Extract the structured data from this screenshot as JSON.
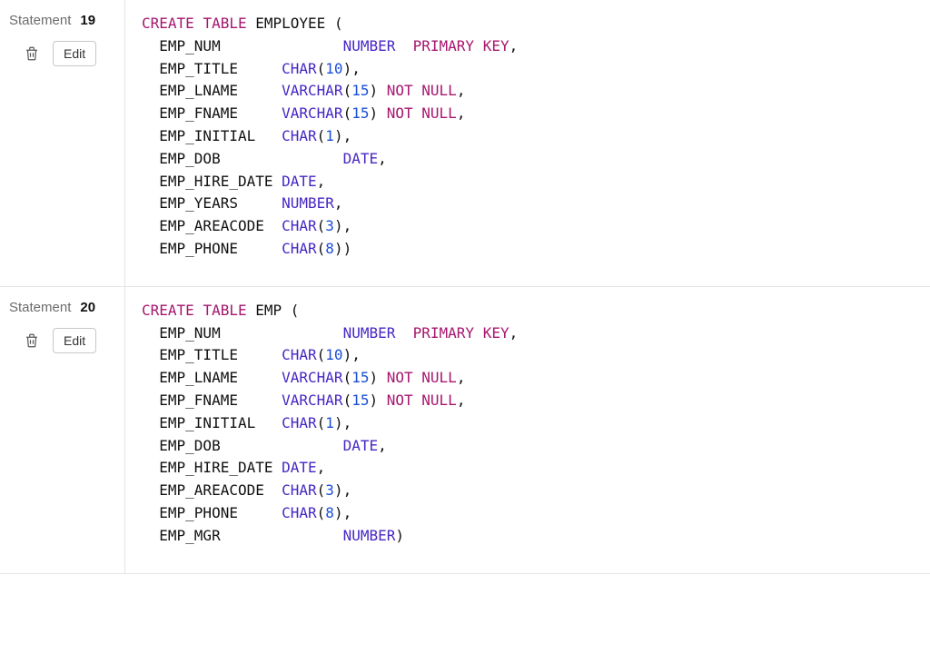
{
  "statement_label": "Statement",
  "edit_label": "Edit",
  "statements": [
    {
      "number": "19",
      "sql": [
        {
          "t": "kw",
          "v": "CREATE"
        },
        {
          "t": "id",
          "v": " "
        },
        {
          "t": "kw",
          "v": "TABLE"
        },
        {
          "t": "id",
          "v": " EMPLOYEE ("
        },
        {
          "t": "nl"
        },
        {
          "t": "id",
          "v": "  EMP_NUM              "
        },
        {
          "t": "type",
          "v": "NUMBER"
        },
        {
          "t": "id",
          "v": "  "
        },
        {
          "t": "kw",
          "v": "PRIMARY"
        },
        {
          "t": "id",
          "v": " "
        },
        {
          "t": "kw",
          "v": "KEY"
        },
        {
          "t": "id",
          "v": ","
        },
        {
          "t": "nl"
        },
        {
          "t": "id",
          "v": "  EMP_TITLE     "
        },
        {
          "t": "type",
          "v": "CHAR"
        },
        {
          "t": "id",
          "v": "("
        },
        {
          "t": "num",
          "v": "10"
        },
        {
          "t": "id",
          "v": "),"
        },
        {
          "t": "nl"
        },
        {
          "t": "id",
          "v": "  EMP_LNAME     "
        },
        {
          "t": "type",
          "v": "VARCHAR"
        },
        {
          "t": "id",
          "v": "("
        },
        {
          "t": "num",
          "v": "15"
        },
        {
          "t": "id",
          "v": ") "
        },
        {
          "t": "kw",
          "v": "NOT"
        },
        {
          "t": "id",
          "v": " "
        },
        {
          "t": "kw",
          "v": "NULL"
        },
        {
          "t": "id",
          "v": ","
        },
        {
          "t": "nl"
        },
        {
          "t": "id",
          "v": "  EMP_FNAME     "
        },
        {
          "t": "type",
          "v": "VARCHAR"
        },
        {
          "t": "id",
          "v": "("
        },
        {
          "t": "num",
          "v": "15"
        },
        {
          "t": "id",
          "v": ") "
        },
        {
          "t": "kw",
          "v": "NOT"
        },
        {
          "t": "id",
          "v": " "
        },
        {
          "t": "kw",
          "v": "NULL"
        },
        {
          "t": "id",
          "v": ","
        },
        {
          "t": "nl"
        },
        {
          "t": "id",
          "v": "  EMP_INITIAL   "
        },
        {
          "t": "type",
          "v": "CHAR"
        },
        {
          "t": "id",
          "v": "("
        },
        {
          "t": "num",
          "v": "1"
        },
        {
          "t": "id",
          "v": "),"
        },
        {
          "t": "nl"
        },
        {
          "t": "id",
          "v": "  EMP_DOB              "
        },
        {
          "t": "type",
          "v": "DATE"
        },
        {
          "t": "id",
          "v": ","
        },
        {
          "t": "nl"
        },
        {
          "t": "id",
          "v": "  EMP_HIRE_DATE "
        },
        {
          "t": "type",
          "v": "DATE"
        },
        {
          "t": "id",
          "v": ","
        },
        {
          "t": "nl"
        },
        {
          "t": "id",
          "v": "  EMP_YEARS     "
        },
        {
          "t": "type",
          "v": "NUMBER"
        },
        {
          "t": "id",
          "v": ","
        },
        {
          "t": "nl"
        },
        {
          "t": "id",
          "v": "  EMP_AREACODE  "
        },
        {
          "t": "type",
          "v": "CHAR"
        },
        {
          "t": "id",
          "v": "("
        },
        {
          "t": "num",
          "v": "3"
        },
        {
          "t": "id",
          "v": "),"
        },
        {
          "t": "nl"
        },
        {
          "t": "id",
          "v": "  EMP_PHONE     "
        },
        {
          "t": "type",
          "v": "CHAR"
        },
        {
          "t": "id",
          "v": "("
        },
        {
          "t": "num",
          "v": "8"
        },
        {
          "t": "id",
          "v": "))"
        }
      ]
    },
    {
      "number": "20",
      "sql": [
        {
          "t": "kw",
          "v": "CREATE"
        },
        {
          "t": "id",
          "v": " "
        },
        {
          "t": "kw",
          "v": "TABLE"
        },
        {
          "t": "id",
          "v": " EMP ("
        },
        {
          "t": "nl"
        },
        {
          "t": "id",
          "v": "  EMP_NUM              "
        },
        {
          "t": "type",
          "v": "NUMBER"
        },
        {
          "t": "id",
          "v": "  "
        },
        {
          "t": "kw",
          "v": "PRIMARY"
        },
        {
          "t": "id",
          "v": " "
        },
        {
          "t": "kw",
          "v": "KEY"
        },
        {
          "t": "id",
          "v": ","
        },
        {
          "t": "nl"
        },
        {
          "t": "id",
          "v": "  EMP_TITLE     "
        },
        {
          "t": "type",
          "v": "CHAR"
        },
        {
          "t": "id",
          "v": "("
        },
        {
          "t": "num",
          "v": "10"
        },
        {
          "t": "id",
          "v": "),"
        },
        {
          "t": "nl"
        },
        {
          "t": "id",
          "v": "  EMP_LNAME     "
        },
        {
          "t": "type",
          "v": "VARCHAR"
        },
        {
          "t": "id",
          "v": "("
        },
        {
          "t": "num",
          "v": "15"
        },
        {
          "t": "id",
          "v": ") "
        },
        {
          "t": "kw",
          "v": "NOT"
        },
        {
          "t": "id",
          "v": " "
        },
        {
          "t": "kw",
          "v": "NULL"
        },
        {
          "t": "id",
          "v": ","
        },
        {
          "t": "nl"
        },
        {
          "t": "id",
          "v": "  EMP_FNAME     "
        },
        {
          "t": "type",
          "v": "VARCHAR"
        },
        {
          "t": "id",
          "v": "("
        },
        {
          "t": "num",
          "v": "15"
        },
        {
          "t": "id",
          "v": ") "
        },
        {
          "t": "kw",
          "v": "NOT"
        },
        {
          "t": "id",
          "v": " "
        },
        {
          "t": "kw",
          "v": "NULL"
        },
        {
          "t": "id",
          "v": ","
        },
        {
          "t": "nl"
        },
        {
          "t": "id",
          "v": "  EMP_INITIAL   "
        },
        {
          "t": "type",
          "v": "CHAR"
        },
        {
          "t": "id",
          "v": "("
        },
        {
          "t": "num",
          "v": "1"
        },
        {
          "t": "id",
          "v": "),"
        },
        {
          "t": "nl"
        },
        {
          "t": "id",
          "v": "  EMP_DOB              "
        },
        {
          "t": "type",
          "v": "DATE"
        },
        {
          "t": "id",
          "v": ","
        },
        {
          "t": "nl"
        },
        {
          "t": "id",
          "v": "  EMP_HIRE_DATE "
        },
        {
          "t": "type",
          "v": "DATE"
        },
        {
          "t": "id",
          "v": ","
        },
        {
          "t": "nl"
        },
        {
          "t": "id",
          "v": "  EMP_AREACODE  "
        },
        {
          "t": "type",
          "v": "CHAR"
        },
        {
          "t": "id",
          "v": "("
        },
        {
          "t": "num",
          "v": "3"
        },
        {
          "t": "id",
          "v": "),"
        },
        {
          "t": "nl"
        },
        {
          "t": "id",
          "v": "  EMP_PHONE     "
        },
        {
          "t": "type",
          "v": "CHAR"
        },
        {
          "t": "id",
          "v": "("
        },
        {
          "t": "num",
          "v": "8"
        },
        {
          "t": "id",
          "v": "),"
        },
        {
          "t": "nl"
        },
        {
          "t": "id",
          "v": "  EMP_MGR              "
        },
        {
          "t": "type",
          "v": "NUMBER"
        },
        {
          "t": "id",
          "v": ")"
        }
      ]
    }
  ]
}
